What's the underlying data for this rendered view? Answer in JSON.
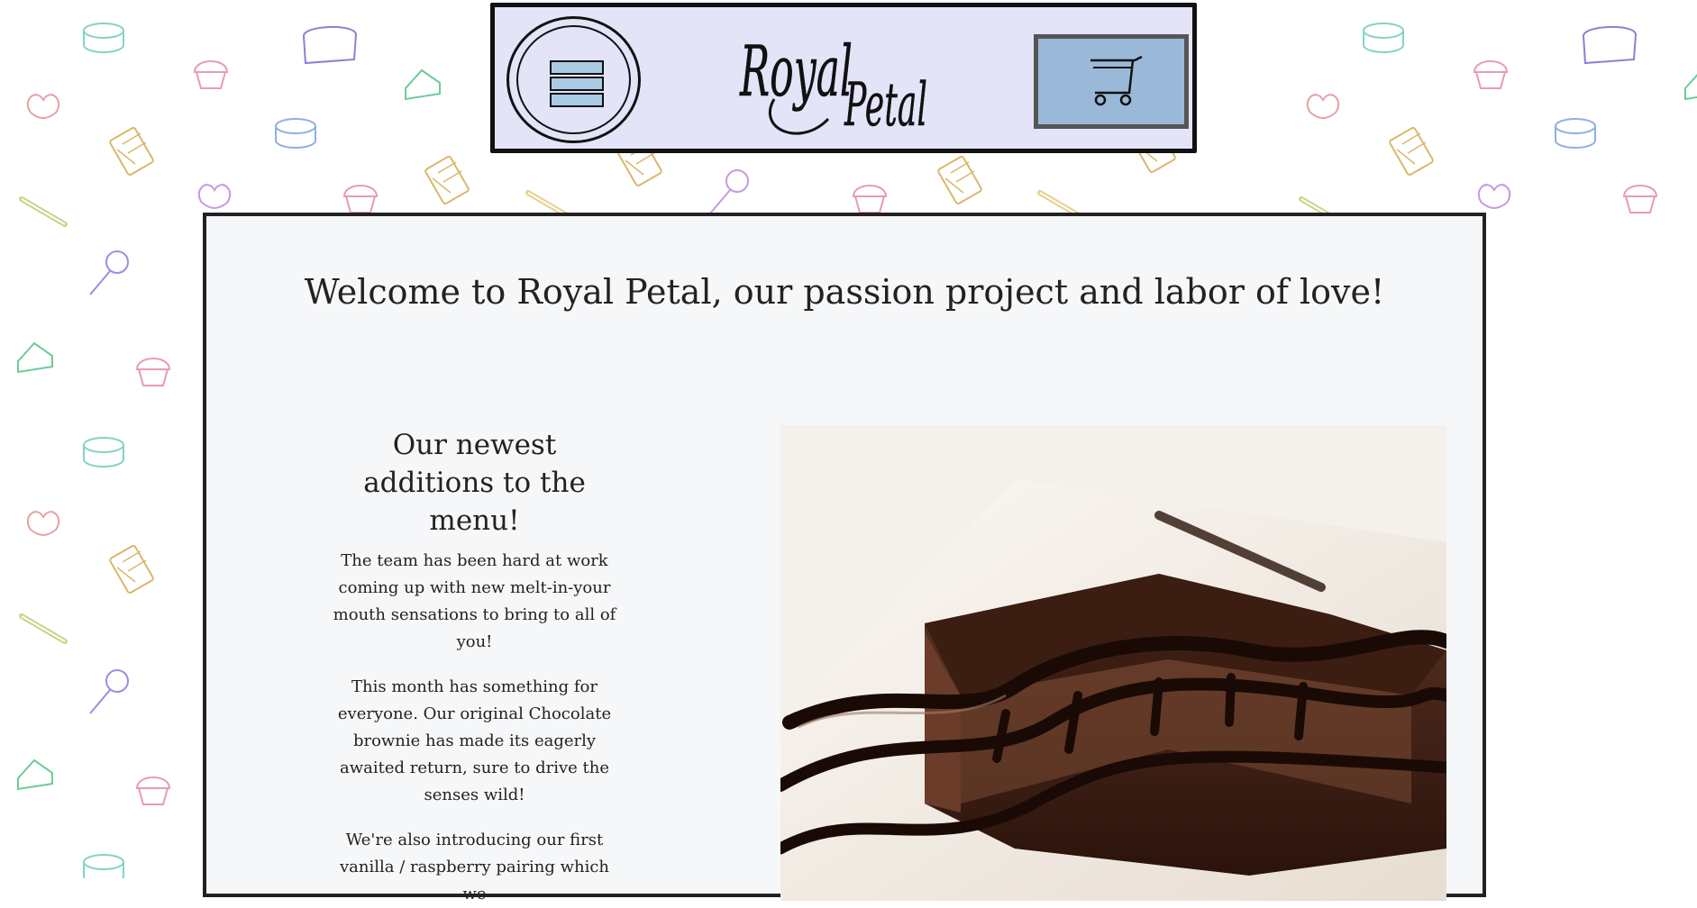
{
  "site": {
    "logo_text_line1": "Royal",
    "logo_text_line2": "Petal"
  },
  "header": {
    "menu_icon": "hamburger-menu-icon",
    "cart_icon": "shopping-cart-icon"
  },
  "main": {
    "welcome_heading": "Welcome to Royal Petal, our passion project and labor of love!",
    "newest_heading": "Our newest additions to the menu!",
    "paragraphs": [
      "The team has been hard at work coming up with new melt-in-your mouth sensations to bring to all of you!",
      "This month has something for everyone. Our original Chocolate brownie has made its eagerly awaited return, sure to drive the senses wild!",
      "We're also introducing our first vanilla / raspberry pairing which we"
    ],
    "photo_subject": "chocolate brownie with chocolate drizzle"
  },
  "colors": {
    "header_bg": "#e4e4f8",
    "menu_bar": "#a9cbe3",
    "cart_bg": "#9ab9d8",
    "panel_bg": "#f6f7f9",
    "text": "#222222"
  }
}
